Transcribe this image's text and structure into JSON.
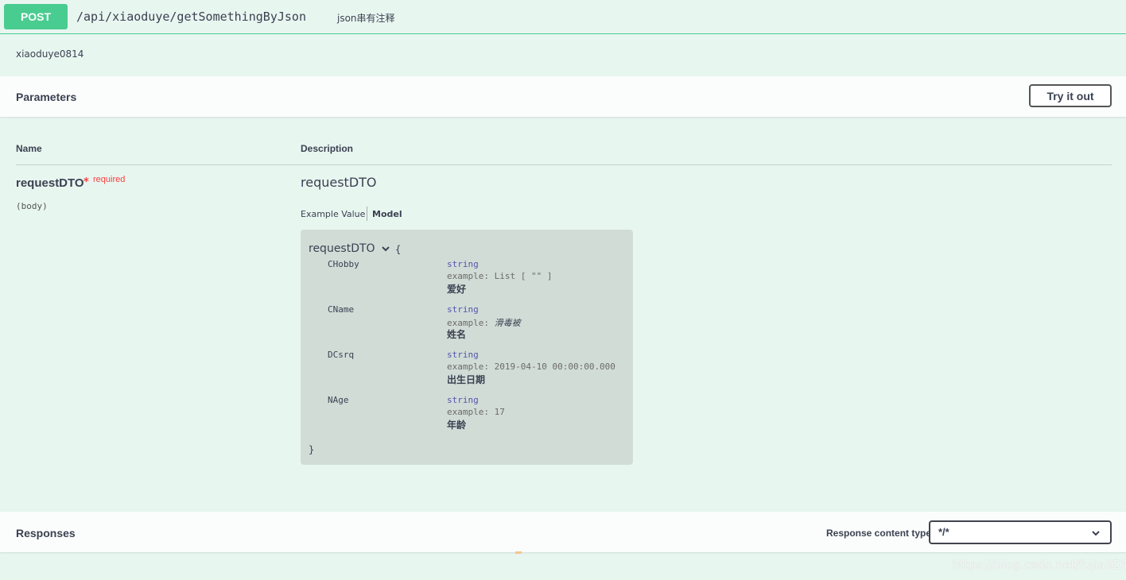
{
  "summary": {
    "method": "POST",
    "path": "/api/xiaoduye/getSomethingByJson",
    "description": "json串有注释"
  },
  "operation": {
    "description": "xiaoduye0814"
  },
  "parameters_section": {
    "title": "Parameters",
    "try_button": "Try it out",
    "col_name": "Name",
    "col_description": "Description",
    "param": {
      "name": "requestDTO",
      "star": "*",
      "required": "required",
      "in": "(body)",
      "description": "requestDTO",
      "tabs": {
        "example": "Example Value",
        "model": "Model"
      },
      "model": {
        "title": "requestDTO",
        "open": "{",
        "close": "}",
        "properties": [
          {
            "name": "CHobby",
            "type": "string",
            "example_label": "example:",
            "example": "List [ \"\" ]",
            "example_italic": false,
            "desc": "爱好"
          },
          {
            "name": "CName",
            "type": "string",
            "example_label": "example:",
            "example": "滑毒被",
            "example_italic": true,
            "desc": "姓名"
          },
          {
            "name": "DCsrq",
            "type": "string",
            "example_label": "example:",
            "example": "2019-04-10 00:00:00.000",
            "example_italic": false,
            "desc": "出生日期"
          },
          {
            "name": "NAge",
            "type": "string",
            "example_label": "example:",
            "example": "17",
            "example_italic": false,
            "desc": "年龄"
          }
        ]
      }
    }
  },
  "responses_section": {
    "title": "Responses",
    "content_type_label": "Response content type",
    "content_type_value": "*/*"
  },
  "watermark": "https://blog.csdn.net/fujiaXDY",
  "colors": {
    "post": "#49cc90",
    "background": "#e8f6f0",
    "required": "#f93e3e",
    "model_bg": "#d1dcd7"
  }
}
